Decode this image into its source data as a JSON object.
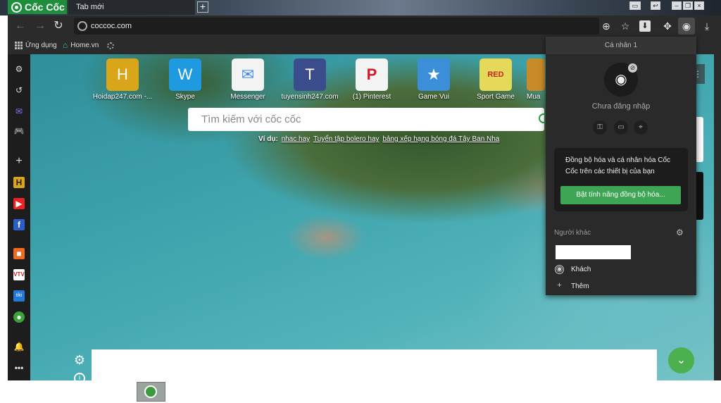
{
  "browser": {
    "brand": "Cốc Cốc",
    "tab_title": "Tab mới",
    "new_tab_symbol": "+",
    "address": "coccoc.com"
  },
  "bookmarks": [
    {
      "label": "Ứng dụng",
      "icon": "apps-grid-icon"
    },
    {
      "label": "Home.vn",
      "icon": "home-icon"
    },
    {
      "label": "",
      "icon": "loading-icon"
    }
  ],
  "shortcuts": [
    {
      "label": "Hoidap247.com -...",
      "letter": "H",
      "bg": "#d9a619"
    },
    {
      "label": "Skype",
      "letter": "W",
      "bg": "#1e9be0"
    },
    {
      "label": "Messenger",
      "letter": "",
      "bg": "#f3f3f3"
    },
    {
      "label": "tuyensinh247.com",
      "letter": "T",
      "bg": "#3b4c8c"
    },
    {
      "label": "(1) Pinterest",
      "letter": "",
      "bg": "#f3f3f3"
    },
    {
      "label": "Game Vui",
      "letter": "",
      "bg": "#3a8fd8"
    },
    {
      "label": "Sport Game",
      "letter": "",
      "bg": "#e5d95a"
    },
    {
      "label": "Mua",
      "letter": "",
      "bg": "#c78b2a"
    }
  ],
  "search": {
    "placeholder": "Tìm kiếm với cốc cốc",
    "suggest_prefix": "Ví dụ:",
    "suggestions": [
      "nhac hay",
      "Tuyển tập bolero hay",
      "bảng xếp hạng bóng đá Tây Ban Nha"
    ]
  },
  "profile_popup": {
    "header": "Cá nhân 1",
    "status": "Chưa đăng nhập",
    "sync_text": "Đồng bộ hóa và cá nhân hóa Cốc Cốc trên các thiết bị của bạn",
    "sync_button": "Bật tính năng đồng bộ hóa...",
    "others_label": "Người khác",
    "guest_label": "Khách",
    "add_label": "Thêm"
  },
  "colors": {
    "brand_green": "#1f8e3c",
    "sync_green": "#3da553",
    "fab_green": "#4caf50"
  }
}
